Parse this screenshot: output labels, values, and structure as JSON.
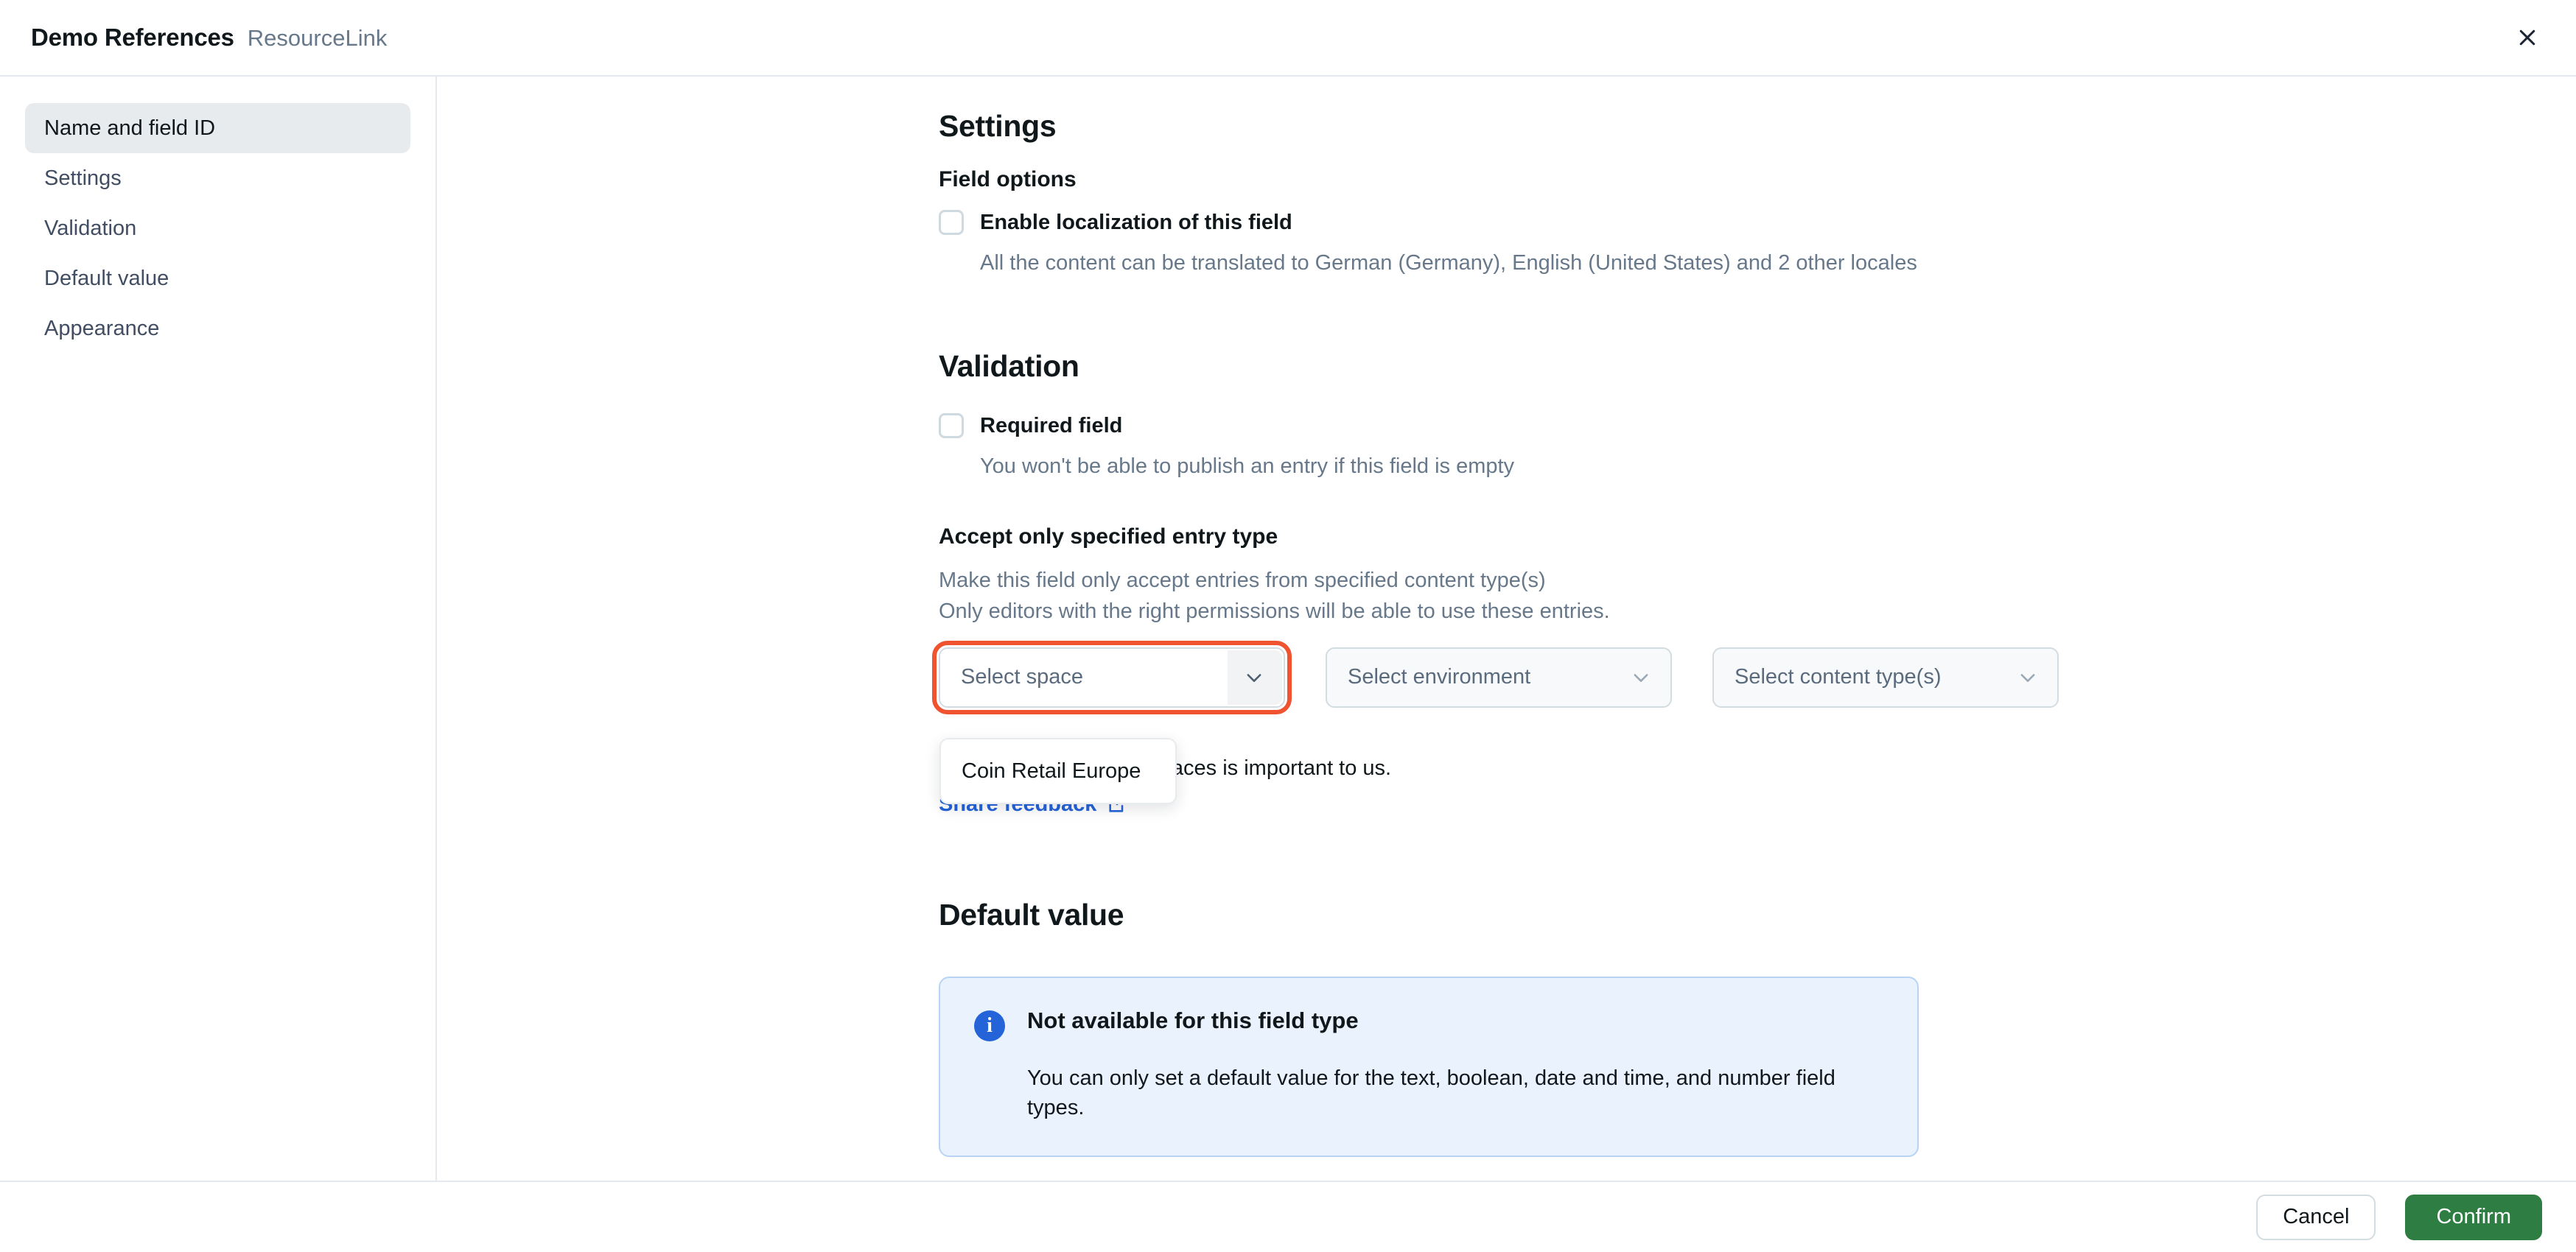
{
  "header": {
    "title": "Demo References",
    "subtitle": "ResourceLink",
    "close_icon": "close-icon"
  },
  "sidebar": {
    "items": [
      {
        "label": "Name and field ID",
        "active": true
      },
      {
        "label": "Settings",
        "active": false
      },
      {
        "label": "Validation",
        "active": false
      },
      {
        "label": "Default value",
        "active": false
      },
      {
        "label": "Appearance",
        "active": false
      }
    ]
  },
  "settings": {
    "title": "Settings",
    "field_options_title": "Field options",
    "localization": {
      "label": "Enable localization of this field",
      "checked": false,
      "help": "All the content can be translated to German (Germany), English (United States) and 2 other locales"
    }
  },
  "validation": {
    "title": "Validation",
    "required": {
      "label": "Required field",
      "checked": false,
      "help": "You won't be able to publish an entry if this field is empty"
    },
    "entry_type": {
      "title": "Accept only specified entry type",
      "help_line1": "Make this field only accept entries from specified content type(s)",
      "help_line2": "Only editors with the right permissions will be able to use these entries."
    },
    "selects": [
      {
        "placeholder": "Select space",
        "value": "",
        "focused": true,
        "icon": "chevron-down-icon"
      },
      {
        "placeholder": "Select environment",
        "value": "",
        "focused": false,
        "icon": "chevron-down-icon"
      },
      {
        "placeholder": "Select content type(s)",
        "value": "",
        "focused": false,
        "icon": "chevron-down-icon"
      }
    ],
    "space_dropdown": {
      "open": true,
      "options": [
        "Coin Retail Europe"
      ]
    },
    "feedback_note": "ing references across spaces is important to us.",
    "feedback_link": "Share feedback",
    "feedback_link_icon": "external-link-icon"
  },
  "default_value": {
    "title": "Default value",
    "note": {
      "icon": "info-icon",
      "icon_glyph": "i",
      "title": "Not available for this field type",
      "body": "You can only set a default value for the text, boolean, date and time, and number field types."
    }
  },
  "footer": {
    "cancel_label": "Cancel",
    "confirm_label": "Confirm"
  },
  "colors": {
    "accent_green": "#2e7d42",
    "focus_orange": "#f05330",
    "link_blue": "#2563d9",
    "info_bg": "#e9f2fd",
    "info_border": "#b9d3f5",
    "sidebar_active_bg": "#e8ebee"
  }
}
